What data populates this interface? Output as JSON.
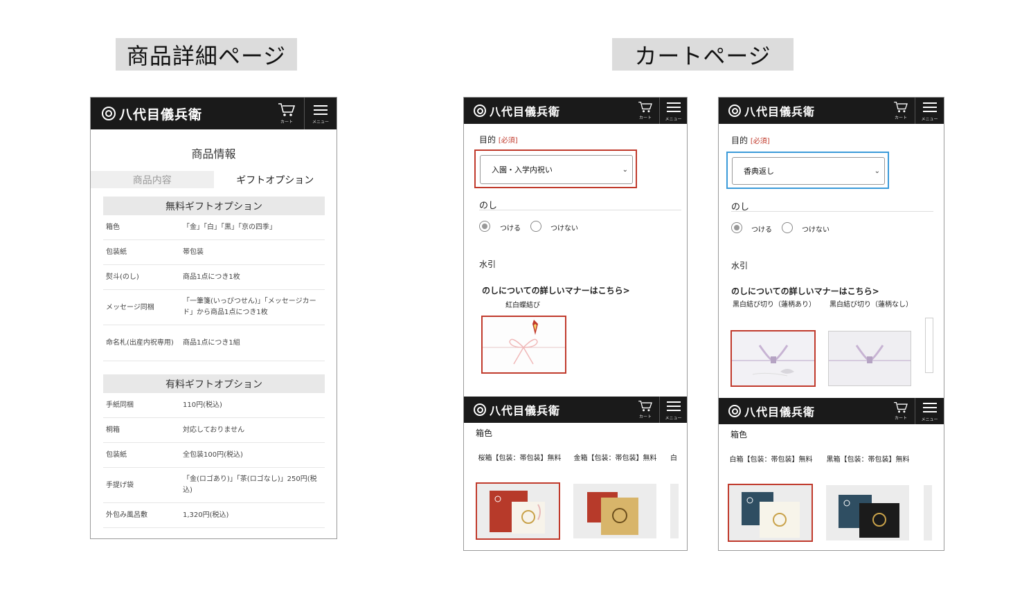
{
  "labels": {
    "detail": "商品詳細ページ",
    "cart": "カートページ"
  },
  "header": {
    "brand": "八代目儀兵衛",
    "cart_label": "カート",
    "menu_label": "メニュー"
  },
  "detail": {
    "title": "商品情報",
    "tabs": [
      "商品内容",
      "ギフトオプション"
    ],
    "free_heading": "無料ギフトオプション",
    "free_rows": [
      {
        "k": "箱色",
        "v": "「金」「白」「黒」「京の四季」"
      },
      {
        "k": "包装紙",
        "v": "帯包装"
      },
      {
        "k": "熨斗(のし)",
        "v": "商品1点につき1枚"
      },
      {
        "k": "メッセージ同梱",
        "v": "「一筆箋(いっぴつせん)」「メッセージカード」から商品1点につき1枚"
      },
      {
        "k": "命名札(出産内祝専用)",
        "v": "商品1点につき1組"
      }
    ],
    "paid_heading": "有料ギフトオプション",
    "paid_rows": [
      {
        "k": "手紙同梱",
        "v": "110円(税込)"
      },
      {
        "k": "桐箱",
        "v": "対応しておりません"
      },
      {
        "k": "包装紙",
        "v": "全包装100円(税込)"
      },
      {
        "k": "手提げ袋",
        "v": "「金(ロゴあり)」「茶(ロゴなし)」250円(税込)"
      },
      {
        "k": "外包み風呂敷",
        "v": "1,320円(税込)"
      }
    ]
  },
  "cart1": {
    "purpose_label": "目的",
    "required": "[必須]",
    "purpose_value": "入園・入学内祝い",
    "noshi_label": "のし",
    "radio_on": "つける",
    "radio_off": "つけない",
    "mizuhiki_label": "水引",
    "manner_link": "のしについての詳しいマナーはこちら>",
    "noshi_options": [
      "紅白蝶結び"
    ],
    "boxcolor_label": "箱色",
    "box_options": [
      "桜箱【包装：帯包装】無料",
      "金箱【包装：帯包装】無料",
      "白"
    ]
  },
  "cart2": {
    "purpose_label": "目的",
    "required": "[必須]",
    "purpose_value": "香典返し",
    "noshi_label": "のし",
    "radio_on": "つける",
    "radio_off": "つけない",
    "mizuhiki_label": "水引",
    "manner_link": "のしについての詳しいマナーはこちら>",
    "noshi_options": [
      "黒白結び切り（蓮柄あり）",
      "黒白結び切り（蓮柄なし）"
    ],
    "boxcolor_label": "箱色",
    "box_options": [
      "白箱【包装：帯包装】無料",
      "黒箱【包装：帯包装】無料"
    ]
  },
  "colors": {
    "header_bg": "#1a1a1a",
    "selected_red": "#c0392b",
    "selected_blue": "#3a9ad9",
    "required_red": "#c0392b"
  }
}
